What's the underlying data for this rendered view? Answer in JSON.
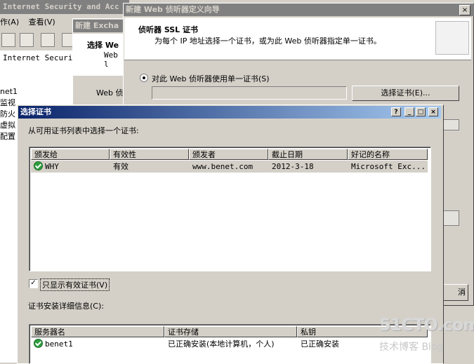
{
  "background_window": {
    "title": "Internet Security and Acc",
    "menu": [
      "作(A)",
      "查看(V)"
    ],
    "tree_items": [
      "Internet Security",
      "net1",
      "监视",
      "防火",
      "虚拟",
      "配置"
    ]
  },
  "behind_dialog": {
    "title": "新建 Excha",
    "heading": "选择 We",
    "sub": "Web l",
    "field_label": "Web 侦"
  },
  "wizard": {
    "title": "新建 Web 侦听器定义向导",
    "heading": "侦听器 SSL 证书",
    "subheading": "为每个 IP 地址选择一个证书，或为此 Web 侦听器指定单一证书。",
    "radio_label": "对此 Web 侦听器使用单一证书(S)",
    "cert_value": "",
    "select_cert_button": "选择证书(E)...",
    "next_fragment": "消"
  },
  "cert_dialog": {
    "title": "选择证书",
    "help_button": "?",
    "minimize_button": "_",
    "maximize_button": "□",
    "close_button": "×",
    "prompt": "从可用证书列表中选择一个证书:",
    "list_columns": [
      "颁发给",
      "有效性",
      "颁发者",
      "截止日期",
      "好记的名称"
    ],
    "list_rows": [
      {
        "issued_to": "WHY",
        "validity": "有效",
        "issuer": "www.benet.com",
        "expiry": "2012-3-18",
        "friendly_name": "Microsoft Exc..."
      }
    ],
    "checkbox_label": "只显示有效证书(V)",
    "checkbox_checked": true,
    "details_label": "证书安装详细信息(C):",
    "details_columns": [
      "服务器名",
      "证书存储",
      "私钥"
    ],
    "details_rows": [
      {
        "server": "benet1",
        "store": "已正确安装(本地计算机，个人)",
        "private_key": "已正确安装"
      }
    ]
  },
  "watermark": {
    "line1": "51CTO.com",
    "line2": "技术博客 Blog"
  }
}
